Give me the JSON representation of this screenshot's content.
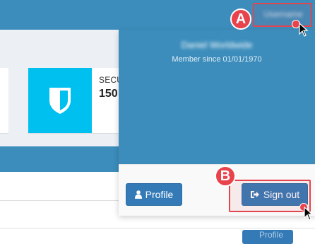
{
  "header": {
    "user_menu_label": "Username"
  },
  "info_box": {
    "title": "SECURITY",
    "value": "150",
    "icon": "shield-icon",
    "icon_color": "#00c0ef"
  },
  "dropdown": {
    "user_name": "Daniel Worldwide",
    "member_since": "Member since 01/01/1970",
    "profile_button": "Profile",
    "signout_button": "Sign out",
    "profile_icon": "user-icon",
    "signout_icon": "sign-out-icon"
  },
  "background_button": "Profile",
  "annotations": {
    "marker_a": "A",
    "marker_b": "B",
    "color": "#e4444d"
  },
  "colors": {
    "primary": "#3c8dbc",
    "button": "#337ab7"
  }
}
